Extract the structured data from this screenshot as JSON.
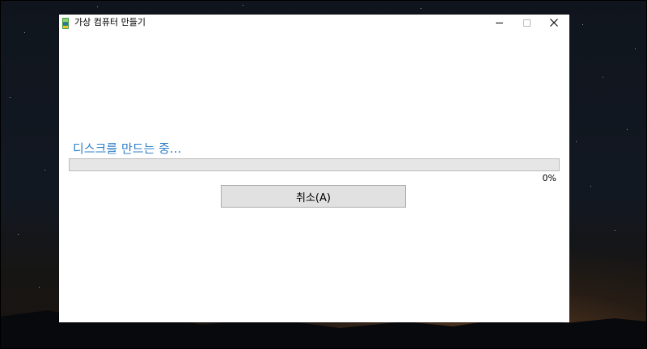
{
  "window": {
    "title": "가상 컴퓨터 만들기",
    "icon": "virtual-disk-app-icon"
  },
  "title_controls": {
    "minimize_icon": "minimize-icon",
    "maximize_icon": "maximize-icon",
    "close_icon": "close-icon"
  },
  "main": {
    "status": "디스크를 만드는 중...",
    "progress": {
      "value_percent": 0,
      "label": "0%",
      "fill_color": "#06b025",
      "track_color": "#e6e6e6"
    },
    "cancel_label": "취소(A)"
  },
  "colors": {
    "status_text": "#2f7fc8"
  }
}
